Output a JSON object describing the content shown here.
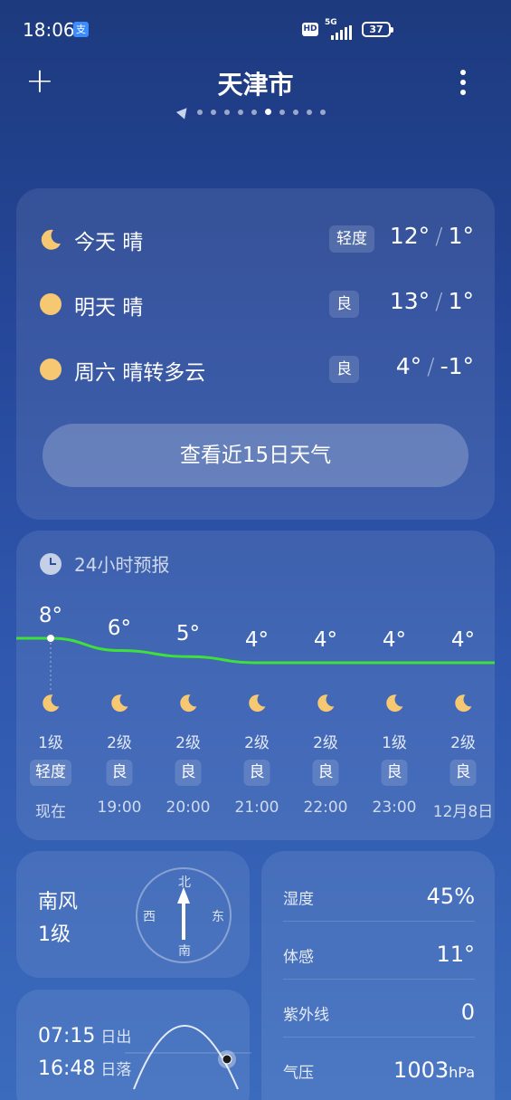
{
  "status_bar": {
    "time": "18:06",
    "app_badge": "支",
    "hd": "HD",
    "network": "5G",
    "battery": "37"
  },
  "header": {
    "add_label": "+",
    "city": "天津市",
    "pager_count": 10,
    "pager_active_index": 5
  },
  "forecast": {
    "days": [
      {
        "icon": "moon-icon",
        "label": "今天  晴",
        "aqi": "轻度",
        "high": "12°",
        "low": "1°"
      },
      {
        "icon": "sun-icon",
        "label": "明天  晴",
        "aqi": "良",
        "high": "13°",
        "low": "1°"
      },
      {
        "icon": "sun-icon",
        "label": "周六  晴转多云",
        "aqi": "良",
        "high": "4°",
        "low": "-1°"
      }
    ],
    "slash": "/",
    "view_15_label": "查看近15日天气"
  },
  "hourly": {
    "title": "24小时预报",
    "items": [
      {
        "temp": "8°",
        "wind": "1级",
        "aqi": "轻度",
        "time": "现在"
      },
      {
        "temp": "6°",
        "wind": "2级",
        "aqi": "良",
        "time": "19:00"
      },
      {
        "temp": "5°",
        "wind": "2级",
        "aqi": "良",
        "time": "20:00"
      },
      {
        "temp": "4°",
        "wind": "2级",
        "aqi": "良",
        "time": "21:00"
      },
      {
        "temp": "4°",
        "wind": "2级",
        "aqi": "良",
        "time": "22:00"
      },
      {
        "temp": "4°",
        "wind": "1级",
        "aqi": "良",
        "time": "23:00"
      },
      {
        "temp": "4°",
        "wind": "2级",
        "aqi": "良",
        "time": "12月8日"
      }
    ],
    "line_color": "#3fe03a"
  },
  "wind": {
    "direction": "南风",
    "level": "1级",
    "compass": {
      "n": "北",
      "s": "南",
      "e": "东",
      "w": "西"
    }
  },
  "sun": {
    "sunrise_time": "07:15",
    "sunrise_label": "日出",
    "sunset_time": "16:48",
    "sunset_label": "日落"
  },
  "details": {
    "humidity_label": "湿度",
    "humidity": "45%",
    "feels_label": "体感",
    "feels": "11°",
    "uv_label": "紫外线",
    "uv": "0",
    "pressure_label": "气压",
    "pressure": "1003",
    "pressure_unit": "hPa"
  }
}
